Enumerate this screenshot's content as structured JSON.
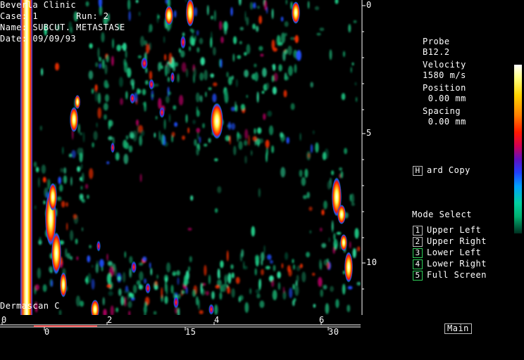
{
  "header": {
    "clinic": "Beverla Clinic",
    "case_line": "Case: 1       Run: 2",
    "name_line": "Name: SUBCUT. METASTASE",
    "date_line": "Date: 09/09/93"
  },
  "footer_label": "Dermascan C",
  "depth_axis": {
    "ticks": [
      "0",
      "5",
      "10"
    ]
  },
  "bottom_axis": {
    "upper_ticks": [
      "0",
      "2",
      "4",
      "6"
    ],
    "lower_ticks": [
      "0",
      "15",
      "30"
    ]
  },
  "info": {
    "probe_label": "Probe",
    "probe_value": "B12.2",
    "velocity_label": "Velocity",
    "velocity_value": "1580 m/s",
    "position_label": "Position",
    "position_value": " 0.00 mm",
    "spacing_label": "Spacing",
    "spacing_value": " 0.00 mm"
  },
  "hardcopy": {
    "key": "H",
    "label": "ard Copy"
  },
  "mode_select": {
    "title": "Mode Select",
    "items": [
      {
        "key": "1",
        "label": "Upper Left"
      },
      {
        "key": "2",
        "label": "Upper Right"
      },
      {
        "key": "3",
        "label": "Lower Left"
      },
      {
        "key": "4",
        "label": "Lower Right"
      },
      {
        "key": "5",
        "label": "Full Screen"
      }
    ]
  },
  "main_button": "Main",
  "colors": {
    "key_border": "#bbbbbb",
    "key_green": "#2fd05a",
    "axis_red": "#ff2020"
  }
}
